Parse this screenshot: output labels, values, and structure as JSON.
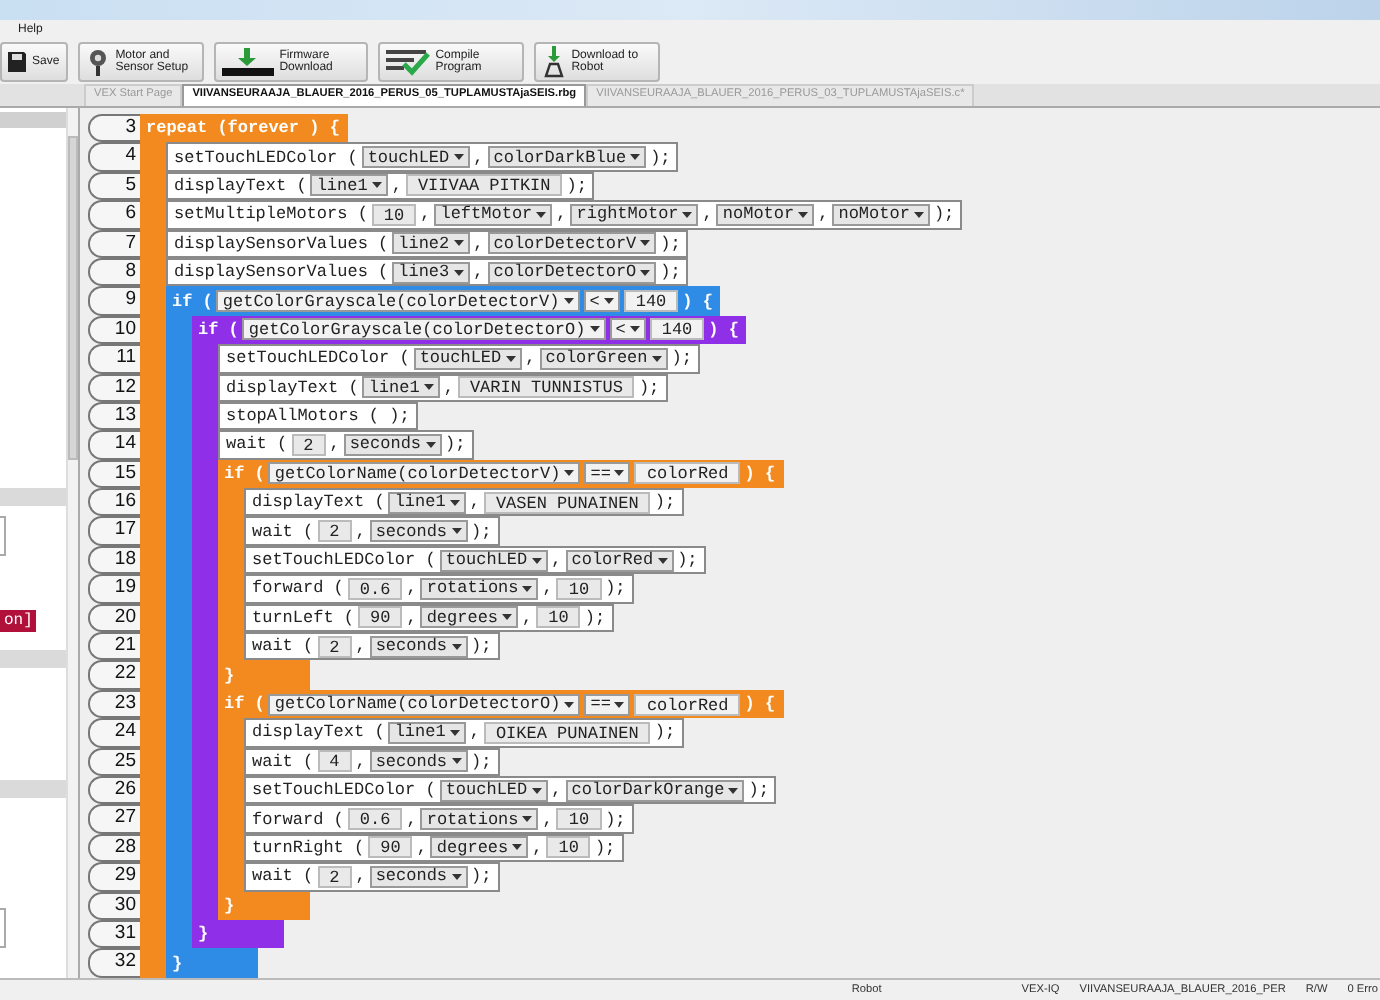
{
  "menu": [
    "Help"
  ],
  "toolbar": [
    {
      "label": "Save",
      "kind": "save"
    },
    {
      "label": "Motor and Sensor Setup",
      "kind": "gear"
    },
    {
      "label": "Firmware Download",
      "kind": "firmware"
    },
    {
      "label": "Compile Program",
      "kind": "compile"
    },
    {
      "label": "Download to Robot",
      "kind": "robot"
    }
  ],
  "tabs": [
    {
      "label": "VEX Start Page",
      "selected": false
    },
    {
      "label": "VIIVANSEURAAJA_BLAUER_2016_PERUS_05_TUPLAMUSTAjaSEIS.rbg",
      "selected": true
    },
    {
      "label": "VIIVANSEURAAJA_BLAUER_2016_PERUS_03_TUPLAMUSTAjaSEIS.c*",
      "selected": false
    }
  ],
  "sidebar": {
    "tag": "on]"
  },
  "editor": {
    "line_numbers": [
      "3",
      "4",
      "5",
      "6",
      "7",
      "8",
      "9",
      "10",
      "11",
      "12",
      "13",
      "14",
      "15",
      "16",
      "17",
      "18",
      "19",
      "20",
      "21",
      "22",
      "23",
      "24",
      "25",
      "26",
      "27",
      "28",
      "29",
      "30",
      "31",
      "32"
    ],
    "blocks": [
      {
        "kind": "repeat",
        "color": "#f28a1f",
        "header": [
          {
            "kind": "text",
            "text": "repeat (forever ) {"
          }
        ],
        "children": [
          {
            "kind": "statement",
            "parts": [
              {
                "kind": "text",
                "text": "setTouchLEDColor ("
              },
              {
                "kind": "dropdown",
                "text": "touchLED"
              },
              {
                "kind": "text",
                "text": ","
              },
              {
                "kind": "dropdown",
                "text": "colorDarkBlue"
              },
              {
                "kind": "text",
                "text": ");"
              }
            ]
          },
          {
            "kind": "statement",
            "parts": [
              {
                "kind": "text",
                "text": "displayText ("
              },
              {
                "kind": "dropdown",
                "text": "line1"
              },
              {
                "kind": "text",
                "text": ","
              },
              {
                "kind": "field",
                "text": "VIIVAA PITKIN"
              },
              {
                "kind": "text",
                "text": ");"
              }
            ]
          },
          {
            "kind": "statement",
            "parts": [
              {
                "kind": "text",
                "text": "setMultipleMotors ("
              },
              {
                "kind": "field",
                "text": "10"
              },
              {
                "kind": "text",
                "text": ","
              },
              {
                "kind": "dropdown",
                "text": "leftMotor"
              },
              {
                "kind": "text",
                "text": ","
              },
              {
                "kind": "dropdown",
                "text": "rightMotor"
              },
              {
                "kind": "text",
                "text": ","
              },
              {
                "kind": "dropdown",
                "text": "noMotor"
              },
              {
                "kind": "text",
                "text": ","
              },
              {
                "kind": "dropdown",
                "text": "noMotor"
              },
              {
                "kind": "text",
                "text": ");"
              }
            ]
          },
          {
            "kind": "statement",
            "parts": [
              {
                "kind": "text",
                "text": "displaySensorValues ("
              },
              {
                "kind": "dropdown",
                "text": "line2"
              },
              {
                "kind": "text",
                "text": ","
              },
              {
                "kind": "dropdown",
                "text": "colorDetectorV"
              },
              {
                "kind": "text",
                "text": ");"
              }
            ]
          },
          {
            "kind": "statement",
            "parts": [
              {
                "kind": "text",
                "text": "displaySensorValues ("
              },
              {
                "kind": "dropdown",
                "text": "line3"
              },
              {
                "kind": "text",
                "text": ","
              },
              {
                "kind": "dropdown",
                "text": "colorDetectorO"
              },
              {
                "kind": "text",
                "text": ");"
              }
            ]
          },
          {
            "kind": "if",
            "color": "#2e8be6",
            "header": [
              {
                "kind": "text",
                "text": "if ("
              },
              {
                "kind": "dropdown",
                "text": "getColorGrayscale(colorDetectorV)"
              },
              {
                "kind": "dropdown",
                "text": "<"
              },
              {
                "kind": "field",
                "text": "140"
              },
              {
                "kind": "text",
                "text": ") {"
              }
            ],
            "footer": "}",
            "children": [
              {
                "kind": "if",
                "color": "#8f2fe8",
                "header": [
                  {
                    "kind": "text",
                    "text": "if ("
                  },
                  {
                    "kind": "dropdown",
                    "text": "getColorGrayscale(colorDetectorO)"
                  },
                  {
                    "kind": "dropdown",
                    "text": "<"
                  },
                  {
                    "kind": "field",
                    "text": "140"
                  },
                  {
                    "kind": "text",
                    "text": ") {"
                  }
                ],
                "footer": "}",
                "children": [
                  {
                    "kind": "statement",
                    "parts": [
                      {
                        "kind": "text",
                        "text": "setTouchLEDColor ("
                      },
                      {
                        "kind": "dropdown",
                        "text": "touchLED"
                      },
                      {
                        "kind": "text",
                        "text": ","
                      },
                      {
                        "kind": "dropdown",
                        "text": "colorGreen"
                      },
                      {
                        "kind": "text",
                        "text": ");"
                      }
                    ]
                  },
                  {
                    "kind": "statement",
                    "parts": [
                      {
                        "kind": "text",
                        "text": "displayText ("
                      },
                      {
                        "kind": "dropdown",
                        "text": "line1"
                      },
                      {
                        "kind": "text",
                        "text": ","
                      },
                      {
                        "kind": "field",
                        "text": "VARIN TUNNISTUS"
                      },
                      {
                        "kind": "text",
                        "text": ");"
                      }
                    ]
                  },
                  {
                    "kind": "statement",
                    "parts": [
                      {
                        "kind": "text",
                        "text": "stopAllMotors ( );"
                      }
                    ]
                  },
                  {
                    "kind": "statement",
                    "parts": [
                      {
                        "kind": "text",
                        "text": "wait ("
                      },
                      {
                        "kind": "field",
                        "text": "2"
                      },
                      {
                        "kind": "text",
                        "text": ","
                      },
                      {
                        "kind": "dropdown",
                        "text": "seconds"
                      },
                      {
                        "kind": "text",
                        "text": ");"
                      }
                    ]
                  },
                  {
                    "kind": "if",
                    "color": "#f28a1f",
                    "header": [
                      {
                        "kind": "text",
                        "text": "if ("
                      },
                      {
                        "kind": "dropdown",
                        "text": "getColorName(colorDetectorV)"
                      },
                      {
                        "kind": "dropdown",
                        "text": "=="
                      },
                      {
                        "kind": "field",
                        "text": "colorRed"
                      },
                      {
                        "kind": "text",
                        "text": ") {"
                      }
                    ],
                    "footer": "}",
                    "children": [
                      {
                        "kind": "statement",
                        "parts": [
                          {
                            "kind": "text",
                            "text": "displayText ("
                          },
                          {
                            "kind": "dropdown",
                            "text": "line1"
                          },
                          {
                            "kind": "text",
                            "text": ","
                          },
                          {
                            "kind": "field",
                            "text": "VASEN PUNAINEN"
                          },
                          {
                            "kind": "text",
                            "text": ");"
                          }
                        ]
                      },
                      {
                        "kind": "statement",
                        "parts": [
                          {
                            "kind": "text",
                            "text": "wait ("
                          },
                          {
                            "kind": "field",
                            "text": "2"
                          },
                          {
                            "kind": "text",
                            "text": ","
                          },
                          {
                            "kind": "dropdown",
                            "text": "seconds"
                          },
                          {
                            "kind": "text",
                            "text": ");"
                          }
                        ]
                      },
                      {
                        "kind": "statement",
                        "parts": [
                          {
                            "kind": "text",
                            "text": "setTouchLEDColor ("
                          },
                          {
                            "kind": "dropdown",
                            "text": "touchLED"
                          },
                          {
                            "kind": "text",
                            "text": ","
                          },
                          {
                            "kind": "dropdown",
                            "text": "colorRed"
                          },
                          {
                            "kind": "text",
                            "text": ");"
                          }
                        ]
                      },
                      {
                        "kind": "statement",
                        "parts": [
                          {
                            "kind": "text",
                            "text": "forward ("
                          },
                          {
                            "kind": "field",
                            "text": "0.6"
                          },
                          {
                            "kind": "text",
                            "text": ","
                          },
                          {
                            "kind": "dropdown",
                            "text": "rotations"
                          },
                          {
                            "kind": "text",
                            "text": ","
                          },
                          {
                            "kind": "field",
                            "text": "10"
                          },
                          {
                            "kind": "text",
                            "text": ");"
                          }
                        ]
                      },
                      {
                        "kind": "statement",
                        "parts": [
                          {
                            "kind": "text",
                            "text": "turnLeft ("
                          },
                          {
                            "kind": "field",
                            "text": "90"
                          },
                          {
                            "kind": "text",
                            "text": ","
                          },
                          {
                            "kind": "dropdown",
                            "text": "degrees"
                          },
                          {
                            "kind": "text",
                            "text": ","
                          },
                          {
                            "kind": "field",
                            "text": "10"
                          },
                          {
                            "kind": "text",
                            "text": ");"
                          }
                        ]
                      },
                      {
                        "kind": "statement",
                        "parts": [
                          {
                            "kind": "text",
                            "text": "wait ("
                          },
                          {
                            "kind": "field",
                            "text": "2"
                          },
                          {
                            "kind": "text",
                            "text": ","
                          },
                          {
                            "kind": "dropdown",
                            "text": "seconds"
                          },
                          {
                            "kind": "text",
                            "text": ");"
                          }
                        ]
                      }
                    ]
                  },
                  {
                    "kind": "if",
                    "color": "#f28a1f",
                    "header": [
                      {
                        "kind": "text",
                        "text": "if ("
                      },
                      {
                        "kind": "dropdown",
                        "text": "getColorName(colorDetectorO)"
                      },
                      {
                        "kind": "dropdown",
                        "text": "=="
                      },
                      {
                        "kind": "field",
                        "text": "colorRed"
                      },
                      {
                        "kind": "text",
                        "text": ") {"
                      }
                    ],
                    "footer": "}",
                    "children": [
                      {
                        "kind": "statement",
                        "parts": [
                          {
                            "kind": "text",
                            "text": "displayText ("
                          },
                          {
                            "kind": "dropdown",
                            "text": "line1"
                          },
                          {
                            "kind": "text",
                            "text": ","
                          },
                          {
                            "kind": "field",
                            "text": "OIKEA PUNAINEN"
                          },
                          {
                            "kind": "text",
                            "text": ");"
                          }
                        ]
                      },
                      {
                        "kind": "statement",
                        "parts": [
                          {
                            "kind": "text",
                            "text": "wait ("
                          },
                          {
                            "kind": "field",
                            "text": "4"
                          },
                          {
                            "kind": "text",
                            "text": ","
                          },
                          {
                            "kind": "dropdown",
                            "text": "seconds"
                          },
                          {
                            "kind": "text",
                            "text": ");"
                          }
                        ]
                      },
                      {
                        "kind": "statement",
                        "parts": [
                          {
                            "kind": "text",
                            "text": "setTouchLEDColor ("
                          },
                          {
                            "kind": "dropdown",
                            "text": "touchLED"
                          },
                          {
                            "kind": "text",
                            "text": ","
                          },
                          {
                            "kind": "dropdown",
                            "text": "colorDarkOrange"
                          },
                          {
                            "kind": "text",
                            "text": ");"
                          }
                        ]
                      },
                      {
                        "kind": "statement",
                        "parts": [
                          {
                            "kind": "text",
                            "text": "forward ("
                          },
                          {
                            "kind": "field",
                            "text": "0.6"
                          },
                          {
                            "kind": "text",
                            "text": ","
                          },
                          {
                            "kind": "dropdown",
                            "text": "rotations"
                          },
                          {
                            "kind": "text",
                            "text": ","
                          },
                          {
                            "kind": "field",
                            "text": "10"
                          },
                          {
                            "kind": "text",
                            "text": ");"
                          }
                        ]
                      },
                      {
                        "kind": "statement",
                        "parts": [
                          {
                            "kind": "text",
                            "text": "turnRight ("
                          },
                          {
                            "kind": "field",
                            "text": "90"
                          },
                          {
                            "kind": "text",
                            "text": ","
                          },
                          {
                            "kind": "dropdown",
                            "text": "degrees"
                          },
                          {
                            "kind": "text",
                            "text": ","
                          },
                          {
                            "kind": "field",
                            "text": "10"
                          },
                          {
                            "kind": "text",
                            "text": ");"
                          }
                        ]
                      },
                      {
                        "kind": "statement",
                        "parts": [
                          {
                            "kind": "text",
                            "text": "wait ("
                          },
                          {
                            "kind": "field",
                            "text": "2"
                          },
                          {
                            "kind": "text",
                            "text": ","
                          },
                          {
                            "kind": "dropdown",
                            "text": "seconds"
                          },
                          {
                            "kind": "text",
                            "text": ");"
                          }
                        ]
                      }
                    ]
                  }
                ]
              }
            ]
          }
        ]
      }
    ]
  },
  "status_bar": [
    "Robot",
    "VEX-IQ",
    "VIIVANSEURAAJA_BLAUER_2016_PER",
    "R/W",
    "0 Erro"
  ]
}
